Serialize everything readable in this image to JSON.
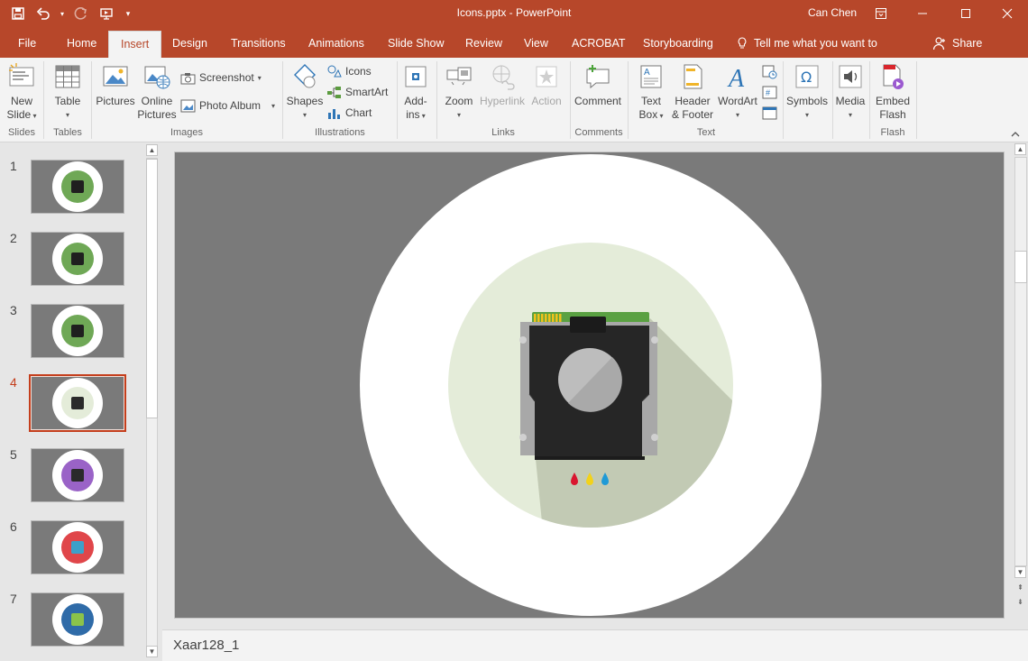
{
  "window": {
    "title": "Icons.pptx  -  PowerPoint",
    "user": "Can Chen"
  },
  "tabs": [
    {
      "label": "File"
    },
    {
      "label": "Home"
    },
    {
      "label": "Insert"
    },
    {
      "label": "Design"
    },
    {
      "label": "Transitions"
    },
    {
      "label": "Animations"
    },
    {
      "label": "Slide Show"
    },
    {
      "label": "Review"
    },
    {
      "label": "View"
    },
    {
      "label": "ACROBAT"
    },
    {
      "label": "Storyboarding"
    }
  ],
  "tell_me": "Tell me what you want to",
  "share": "Share",
  "ribbon": {
    "new_slide": [
      "New",
      "Slide"
    ],
    "table": "Table",
    "pictures": "Pictures",
    "online_pictures": [
      "Online",
      "Pictures"
    ],
    "screenshot": "Screenshot",
    "photo_album": "Photo Album",
    "shapes": "Shapes",
    "icons": "Icons",
    "smartart": "SmartArt",
    "chart": "Chart",
    "addins": [
      "Add-",
      "ins"
    ],
    "zoom": "Zoom",
    "hyperlink": "Hyperlink",
    "action": "Action",
    "comment": "Comment",
    "text_box": [
      "Text",
      "Box"
    ],
    "header_footer": [
      "Header",
      "& Footer"
    ],
    "wordart": "WordArt",
    "symbols": "Symbols",
    "media": "Media",
    "embed_flash": [
      "Embed",
      "Flash"
    ],
    "groups": {
      "slides": "Slides",
      "tables": "Tables",
      "images": "Images",
      "illustrations": "Illustrations",
      "links": "Links",
      "comments": "Comments",
      "text": "Text",
      "flash": "Flash"
    }
  },
  "thumbnails": [
    {
      "num": "1",
      "inner": "#6fa856",
      "glyph": "#1f1f1f"
    },
    {
      "num": "2",
      "inner": "#6fa856",
      "glyph": "#1f1f1f"
    },
    {
      "num": "3",
      "inner": "#6fa856",
      "glyph": "#1f1f1f"
    },
    {
      "num": "4",
      "inner": "#e4ecd9",
      "glyph": "#2a2a2a"
    },
    {
      "num": "5",
      "inner": "#9a63c7",
      "glyph": "#2a2a2a"
    },
    {
      "num": "6",
      "inner": "#e0464a",
      "glyph": "#3da0c9"
    },
    {
      "num": "7",
      "inner": "#2f6ba8",
      "glyph": "#8bc34a"
    }
  ],
  "selected_slide": "4",
  "notes": "Xaar128_1",
  "colors": {
    "accent": "#b7472a",
    "selected_border": "#c43e1c",
    "slide_bg": "#7a7a7a",
    "inner_circle": "#e4ecd9",
    "shadow": "#c2cab4",
    "printhead_body": "#a8a8a8",
    "printhead_dark": "#262626",
    "pcb_green": "#5aa142",
    "contacts_yellow": "#f2c21b",
    "ink_cyan": "#1f9ad6",
    "ink_magenta": "#d9162f",
    "ink_yellow": "#f2d21a"
  }
}
